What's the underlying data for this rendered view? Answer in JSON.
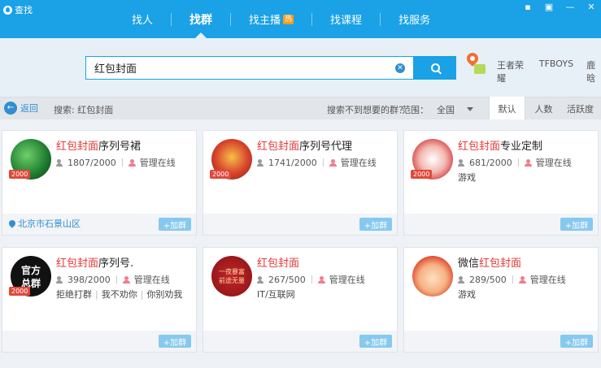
{
  "app": {
    "title": "查找"
  },
  "nav": {
    "tabs": [
      {
        "label": "找人"
      },
      {
        "label": "找群"
      },
      {
        "label": "找主播",
        "badge": "热"
      },
      {
        "label": "找课程"
      },
      {
        "label": "找服务"
      }
    ],
    "active_index": 1
  },
  "search": {
    "value": "红包封面",
    "clear_icon": "clear-icon",
    "button_icon": "search-icon"
  },
  "hot_tags": [
    "王者荣耀",
    "TFBOYS",
    "鹿晗"
  ],
  "filter": {
    "back_label": "返回",
    "crumb": "搜索: 红包封面",
    "not_found": "搜索不到想要的群？",
    "range_label": "范围：",
    "range_value": "全国",
    "sort_tabs": [
      "默认",
      "人数",
      "活跃度"
    ]
  },
  "cards": [
    {
      "highlight": "红包封面",
      "rest": "序列号裙",
      "members": "1807/2000",
      "admin": "管理在线",
      "level": "2000",
      "tags": [],
      "location": "北京市石景山区",
      "add": "+加群"
    },
    {
      "highlight": "红包封面",
      "rest": "序列号代理",
      "members": "1741/2000",
      "admin": "管理在线",
      "level": "2000",
      "tags": [],
      "location": "",
      "add": "+加群"
    },
    {
      "highlight": "红包封面",
      "rest": "专业定制",
      "members": "681/2000",
      "admin": "管理在线",
      "level": "2000",
      "tags": [
        "游戏"
      ],
      "location": "",
      "add": "+加群"
    },
    {
      "highlight": "红包封面",
      "rest": "序列号.",
      "members": "398/2000",
      "admin": "管理在线",
      "level": "2000",
      "tags": [
        "拒绝打群",
        "我不劝你",
        "你别劝我"
      ],
      "location": "",
      "add": "+加群",
      "avatar_text": "官方总群"
    },
    {
      "highlight": "红包封面",
      "rest": "",
      "members": "267/500",
      "admin": "管理在线",
      "level": "",
      "tags": [
        "IT/互联网"
      ],
      "location": "",
      "add": "+加群",
      "avatar_text": "一夜暴富 前途无量"
    },
    {
      "prefix": "微信",
      "highlight": "红包封面",
      "rest": "",
      "members": "289/500",
      "admin": "管理在线",
      "level": "",
      "tags": [
        "游戏"
      ],
      "location": "",
      "add": "+加群"
    }
  ],
  "colors": {
    "brand": "#1aa1e6",
    "highlight": "#e53935",
    "add_button": "#86c9ef"
  }
}
